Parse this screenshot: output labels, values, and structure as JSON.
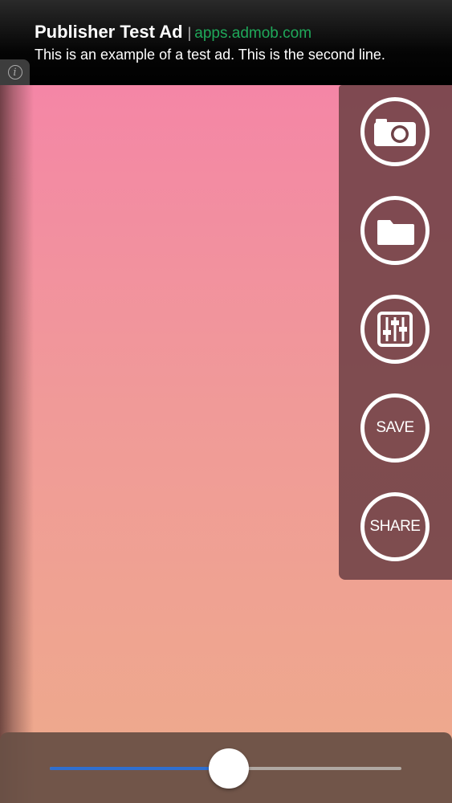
{
  "ad": {
    "title": "Publisher Test Ad",
    "separator": "|",
    "url": "apps.admob.com",
    "line2": "This is an example of a test ad. This is the second line.",
    "info_icon": "info-icon"
  },
  "toolbar": {
    "items": [
      {
        "icon": "camera-icon"
      },
      {
        "icon": "folder-icon"
      },
      {
        "icon": "sliders-icon"
      },
      {
        "label": "SAVE"
      },
      {
        "label": "SHARE"
      }
    ]
  },
  "slider": {
    "value": 0.51
  },
  "colors": {
    "accent": "#2f6fd0",
    "ad_url": "#1fa95a"
  }
}
